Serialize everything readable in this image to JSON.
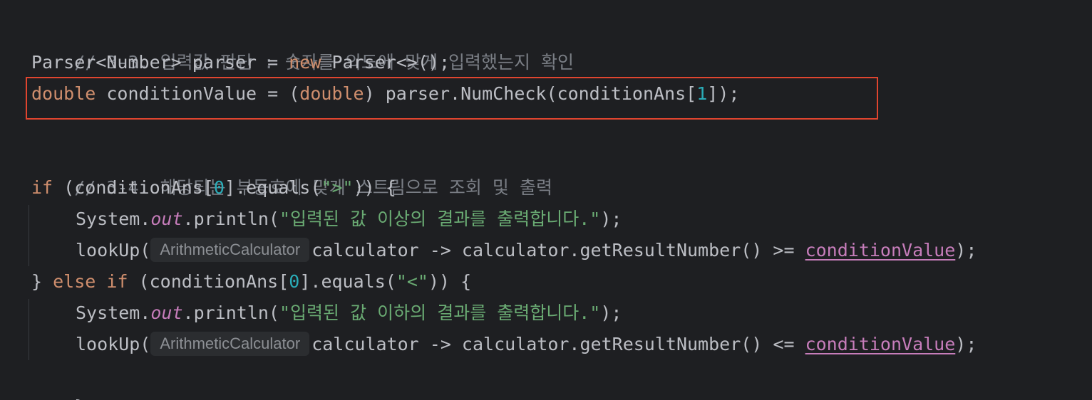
{
  "code": {
    "comment_1": "// 3-3. 입력값 판단 : 숫자를 의도에 맞게 입력했는지 확인",
    "line_parser": {
      "type": "Parser<Number>",
      "assign": " parser = ",
      "kw_new": "new",
      "ctor": " Parser<>();"
    },
    "line_double": {
      "kw_double": "double",
      "decl": " conditionValue = (",
      "kw_double_cast": "double",
      "call": ") parser.NumCheck(conditionAns[",
      "index": "1",
      "end": "]);"
    },
    "comment_2": "// 3-4. 해당되는 부등호에 맞게 스트림으로 조회 및 출력",
    "line_if": {
      "kw_if": "if",
      "cond_a": " (conditionAns[",
      "index": "0",
      "cond_b": "].equals(",
      "str": "\">\"",
      "end": ")) {"
    },
    "line_print_1": {
      "system": "System.",
      "out": "out",
      "call": ".println(",
      "str": "\"입력된 값 이상의 결과를 출력합니다.\"",
      "end": ");"
    },
    "line_lookup_1": {
      "call": "lookUp(",
      "hint": "ArithmeticCalculator",
      "lambda": "calculator -> calculator.getResultNumber() >= ",
      "field": "conditionValue",
      "end": ");"
    },
    "line_else_if": {
      "brace": "} ",
      "kw_else": "else",
      "space": " ",
      "kw_if": "if",
      "cond_a": " (conditionAns[",
      "index": "0",
      "cond_b": "].equals(",
      "str": "\"<\"",
      "end": ")) {"
    },
    "line_print_2": {
      "system": "System.",
      "out": "out",
      "call": ".println(",
      "str": "\"입력된 값 이하의 결과를 출력합니다.\"",
      "end": ");"
    },
    "line_lookup_2": {
      "call": "lookUp(",
      "hint": "ArithmeticCalculator",
      "lambda": "calculator -> calculator.getResultNumber() <= ",
      "field": "conditionValue",
      "end": ");"
    },
    "line_close": "}"
  },
  "colors": {
    "background": "#1e1f22",
    "default_text": "#bcbec4",
    "comment": "#7a7e85",
    "keyword": "#cf8e6d",
    "number": "#2aacb8",
    "string": "#6aab73",
    "field": "#c77dbb",
    "highlight_border": "#e0452f"
  }
}
